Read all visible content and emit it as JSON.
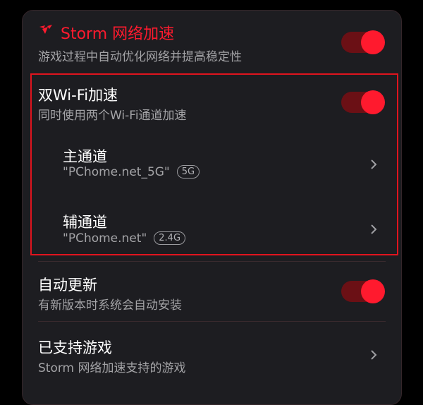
{
  "header": {
    "title": "Storm 网络加速",
    "subtitle": "游戏过程中自动优化网络并提高稳定性",
    "icon": "storm-logo-icon",
    "toggle_on": true,
    "accent": "#ff1a2e"
  },
  "dual_wifi": {
    "title": "双Wi-Fi加速",
    "subtitle": "同时使用两个Wi-Fi通道加速",
    "toggle_on": true
  },
  "primary_channel": {
    "title": "主通道",
    "network": "\"PChome.net_5G\"",
    "band": "5G"
  },
  "secondary_channel": {
    "title": "辅通道",
    "network": "\"PChome.net\"",
    "band": "2.4G"
  },
  "auto_update": {
    "title": "自动更新",
    "subtitle": "有新版本时系统会自动安装",
    "toggle_on": true
  },
  "supported_games": {
    "title": "已支持游戏",
    "subtitle": "Storm 网络加速支持的游戏"
  }
}
